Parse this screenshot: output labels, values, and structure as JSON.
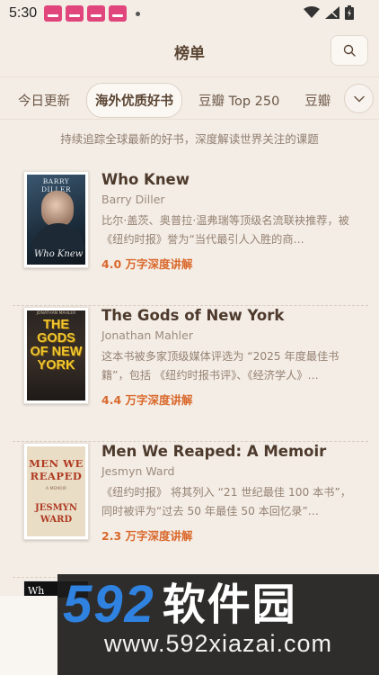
{
  "status_bar": {
    "time": "5:30",
    "notification_icons": [
      "app-icon",
      "app-icon",
      "app-icon",
      "app-icon"
    ]
  },
  "header": {
    "title": "榜单",
    "search_icon": "search-icon"
  },
  "tabs": [
    {
      "label": "今日更新",
      "active": false
    },
    {
      "label": "海外优质好书",
      "active": true
    },
    {
      "label": "豆瓣 Top 250",
      "active": false
    },
    {
      "label": "豆瓣",
      "active": false
    }
  ],
  "subtitle": "持续追踪全球最新的好书，深度解读世界关注的课题",
  "books": [
    {
      "title": "Who Knew",
      "author": "Barry Diller",
      "description": "比尔·盖茨、奥普拉·温弗瑞等顶级名流联袂推荐，被《纽约时报》誉为“当代最引人入胜的商…",
      "badge": "4.0 万字深度讲解",
      "cover_text": {
        "name": "BARRY DILLER",
        "script": "Who Knew"
      }
    },
    {
      "title": "The Gods of New York",
      "author": "Jonathan Mahler",
      "description": "这本书被多家顶级媒体评选为 “2025 年度最佳书籍”，包括 《纽约时报书评》、《经济学人》…",
      "badge": "4.4 万字深度讲解",
      "cover_text": {
        "header": "JONATHAN MAHLER",
        "big": "THE GODS OF NEW YORK"
      }
    },
    {
      "title": "Men We Reaped: A Memoir",
      "author": "Jesmyn Ward",
      "description": "《纽约时报》 将其列入 “21 世纪最佳 100 本书”，同时被评为“过去 50 年最佳 50 本回忆录”…",
      "badge": "2.3 万字深度讲解",
      "cover_text": {
        "big": "MEN WE REAPED",
        "small": "A MEMOIR",
        "author": "JESMYN WARD"
      }
    }
  ],
  "partial_cover_text": "Wh",
  "watermark": {
    "logo_number": "592",
    "logo_text": "软件园",
    "url": "www.592xiazai.com"
  },
  "colors": {
    "background": "#f4ede6",
    "accent": "#d9692c",
    "watermark_blue": "#2f82e0"
  }
}
